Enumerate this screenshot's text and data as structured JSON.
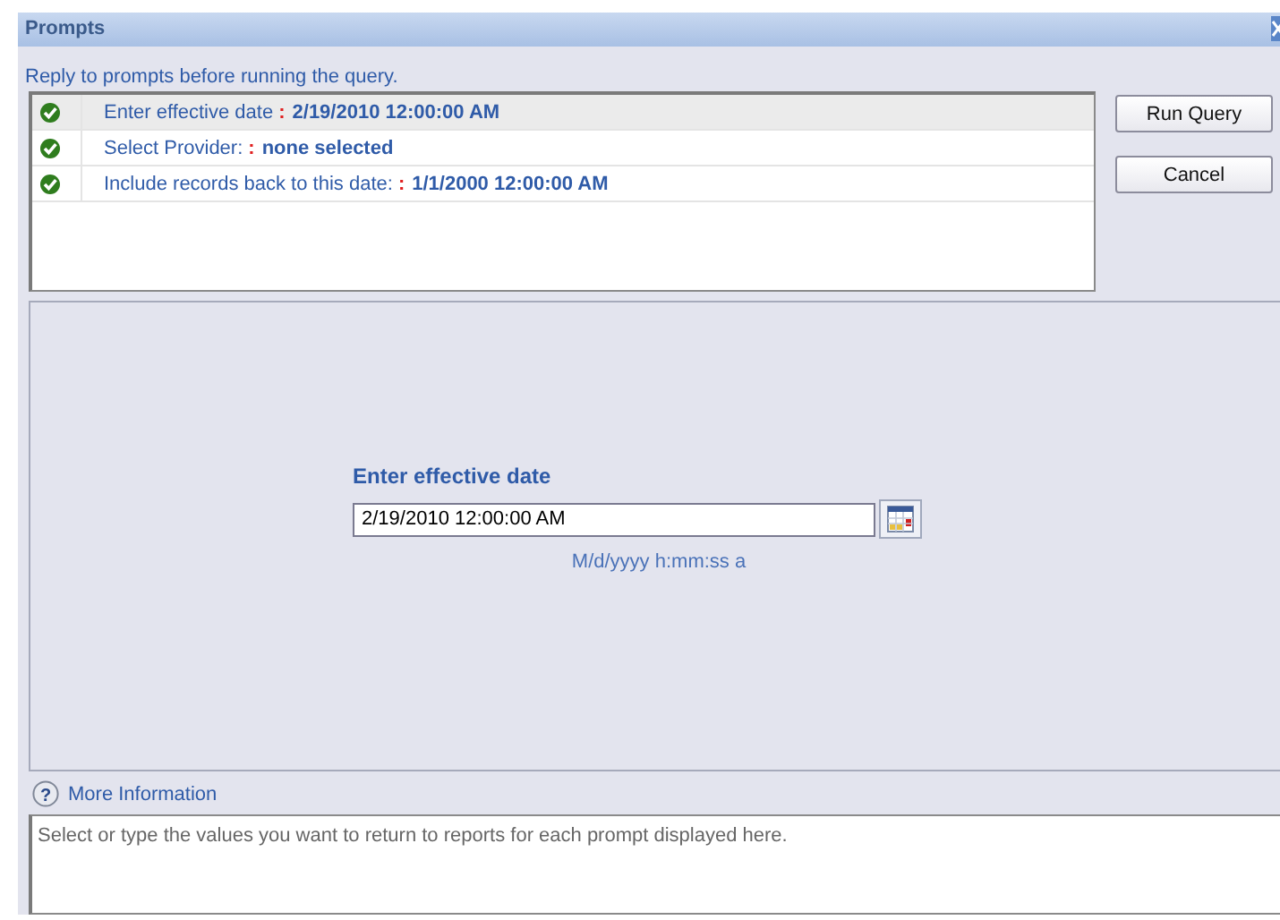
{
  "window": {
    "title": "Prompts"
  },
  "instruction": "Reply to prompts before running the query.",
  "prompts": [
    {
      "label": "Enter effective date",
      "separator": ":",
      "value": "2/19/2010 12:00:00 AM",
      "answered": true,
      "selected": true
    },
    {
      "label": "Select Provider:",
      "separator": ":",
      "value": "none selected",
      "answered": true,
      "selected": false
    },
    {
      "label": "Include records back to this date:",
      "separator": ":",
      "value": "1/1/2000 12:00:00 AM",
      "answered": true,
      "selected": false
    }
  ],
  "buttons": [
    "Run Query",
    "Cancel"
  ],
  "editor": {
    "heading": "Enter effective date",
    "value": "2/19/2010 12:00:00 AM",
    "format": "M/d/yyyy h:mm:ss a"
  },
  "more_info": {
    "icon": "?",
    "label": "More Information",
    "text": "Select or type the values you want to return to reports for each prompt displayed here."
  }
}
